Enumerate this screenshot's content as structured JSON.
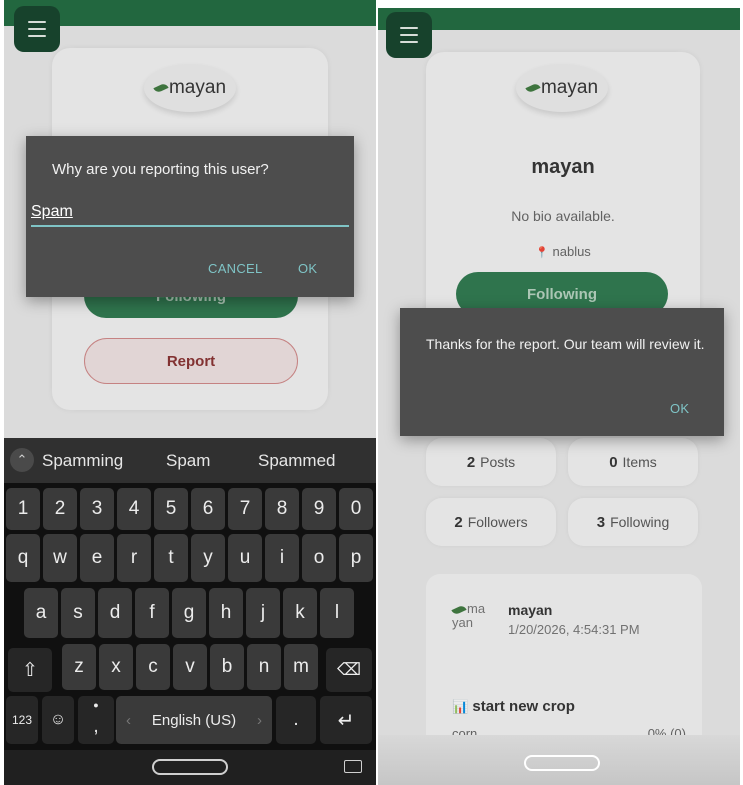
{
  "left_screen": {
    "logo": {
      "text": "mayan"
    },
    "follow_button": {
      "label": "Following"
    },
    "report_button": {
      "label": "Report"
    },
    "dialog": {
      "title": "Why are you reporting this user?",
      "input_value": "Spam",
      "cancel_label": "CANCEL",
      "ok_label": "OK"
    },
    "keyboard": {
      "suggestions": [
        "Spamming",
        "Spam",
        "Spammed"
      ],
      "row_numbers": [
        "1",
        "2",
        "3",
        "4",
        "5",
        "6",
        "7",
        "8",
        "9",
        "0"
      ],
      "row_1": [
        "q",
        "w",
        "e",
        "r",
        "t",
        "y",
        "u",
        "i",
        "o",
        "p"
      ],
      "row_2": [
        "a",
        "s",
        "d",
        "f",
        "g",
        "h",
        "j",
        "k",
        "l"
      ],
      "row_3": [
        "z",
        "x",
        "c",
        "v",
        "b",
        "n",
        "m"
      ],
      "symbols_label": "123",
      "emoji_glyph": "☺",
      "comma_glyph": ",",
      "period_glyph": ".",
      "space_label": "English (US)",
      "shift_glyph": "⇧",
      "backspace_glyph": "⌫",
      "enter_glyph": "↵"
    }
  },
  "right_screen": {
    "logo": {
      "text": "mayan"
    },
    "profile": {
      "name": "mayan",
      "bio": "No bio available.",
      "location": "nablus",
      "location_icon": "📍"
    },
    "follow_button": {
      "label": "Following"
    },
    "dialog": {
      "message": "Thanks for the report. Our team will review it.",
      "ok_label": "OK"
    },
    "stats": {
      "posts_count": "2",
      "posts_label": "Posts",
      "items_count": "0",
      "items_label": "Items",
      "followers_count": "2",
      "followers_label": "Followers",
      "following_count": "3",
      "following_label": "Following"
    },
    "post": {
      "avatar_alt_line1": "ma",
      "avatar_alt_line2": "yan",
      "author": "mayan",
      "timestamp": "1/20/2026, 4:54:31 PM",
      "crop_icon": "📊",
      "title": "start new crop",
      "crop_name": "corn",
      "progress": "0% (0)"
    }
  },
  "colors": {
    "topbar_green": "#1f6b3f",
    "follow_green": "#2d7a4f",
    "dialog_bg": "#4d4d4d",
    "dialog_accent": "#7fc4c6",
    "report_border": "#d48a8a"
  }
}
